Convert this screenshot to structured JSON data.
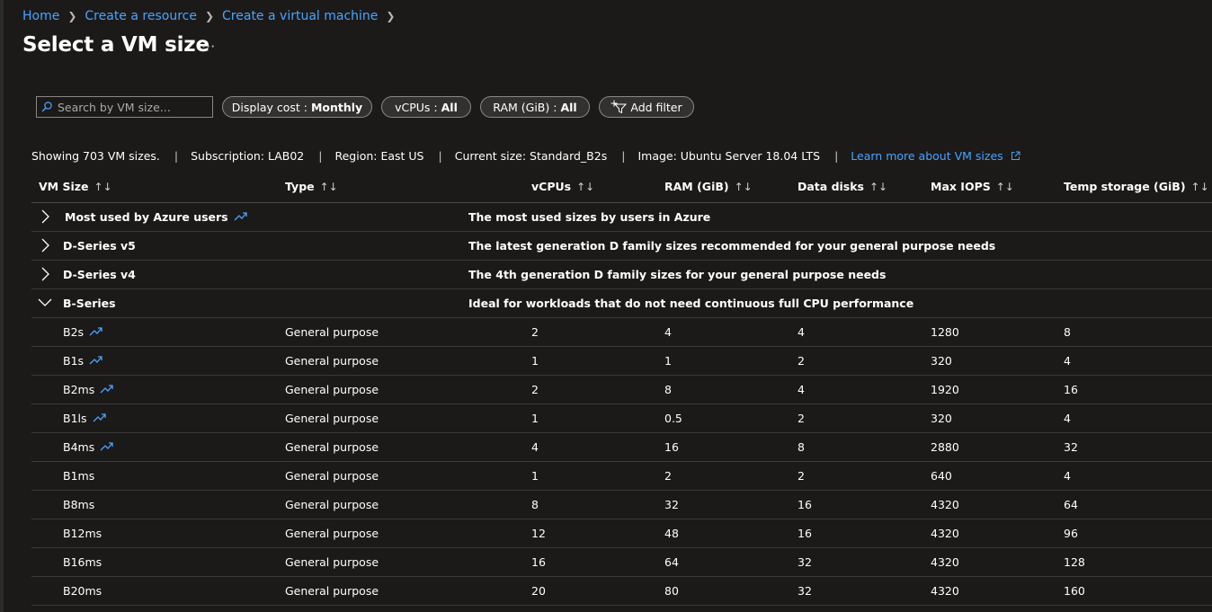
{
  "breadcrumb": {
    "home": "Home",
    "create_resource": "Create a resource",
    "create_vm": "Create a virtual machine"
  },
  "page": {
    "title": "Select a VM size",
    "more": "···"
  },
  "toolbar": {
    "search_placeholder": "Search by VM size...",
    "display_cost_label": "Display cost :",
    "display_cost_value": "Monthly",
    "vcpus_label": "vCPUs :",
    "vcpus_value": "All",
    "ram_label": "RAM (GiB) :",
    "ram_value": "All",
    "add_filter": "Add filter"
  },
  "summary": {
    "showing": "Showing 703 VM sizes.",
    "subscription": "Subscription: LAB02",
    "region": "Region: East US",
    "current_size": "Current size: Standard_B2s",
    "image": "Image: Ubuntu Server 18.04 LTS",
    "learn_more": "Learn more about VM sizes"
  },
  "columns": [
    "VM Size",
    "Type",
    "vCPUs",
    "RAM (GiB)",
    "Data disks",
    "Max IOPS",
    "Temp storage (GiB)"
  ],
  "groups": [
    {
      "name": "Most used by Azure users",
      "description": "The most used sizes by users in Azure",
      "expanded": false,
      "trend_icon": true
    },
    {
      "name": "D-Series v5",
      "description": "The latest generation D family sizes recommended for your general purpose needs",
      "expanded": false,
      "trend_icon": false
    },
    {
      "name": "D-Series v4",
      "description": "The 4th generation D family sizes for your general purpose needs",
      "expanded": false,
      "trend_icon": false
    },
    {
      "name": "B-Series",
      "description": "Ideal for workloads that do not need continuous full CPU performance",
      "expanded": true,
      "trend_icon": false
    }
  ],
  "rows": [
    {
      "size": "B2s",
      "trend": true,
      "type": "General purpose",
      "vcpus": "2",
      "ram": "4",
      "disks": "4",
      "iops": "1280",
      "temp": "8"
    },
    {
      "size": "B1s",
      "trend": true,
      "type": "General purpose",
      "vcpus": "1",
      "ram": "1",
      "disks": "2",
      "iops": "320",
      "temp": "4"
    },
    {
      "size": "B2ms",
      "trend": true,
      "type": "General purpose",
      "vcpus": "2",
      "ram": "8",
      "disks": "4",
      "iops": "1920",
      "temp": "16"
    },
    {
      "size": "B1ls",
      "trend": true,
      "type": "General purpose",
      "vcpus": "1",
      "ram": "0.5",
      "disks": "2",
      "iops": "320",
      "temp": "4"
    },
    {
      "size": "B4ms",
      "trend": true,
      "type": "General purpose",
      "vcpus": "4",
      "ram": "16",
      "disks": "8",
      "iops": "2880",
      "temp": "32"
    },
    {
      "size": "B1ms",
      "trend": false,
      "type": "General purpose",
      "vcpus": "1",
      "ram": "2",
      "disks": "2",
      "iops": "640",
      "temp": "4"
    },
    {
      "size": "B8ms",
      "trend": false,
      "type": "General purpose",
      "vcpus": "8",
      "ram": "32",
      "disks": "16",
      "iops": "4320",
      "temp": "64"
    },
    {
      "size": "B12ms",
      "trend": false,
      "type": "General purpose",
      "vcpus": "12",
      "ram": "48",
      "disks": "16",
      "iops": "4320",
      "temp": "96"
    },
    {
      "size": "B16ms",
      "trend": false,
      "type": "General purpose",
      "vcpus": "16",
      "ram": "64",
      "disks": "32",
      "iops": "4320",
      "temp": "128"
    },
    {
      "size": "B20ms",
      "trend": false,
      "type": "General purpose",
      "vcpus": "20",
      "ram": "80",
      "disks": "32",
      "iops": "4320",
      "temp": "160"
    }
  ],
  "colors": {
    "background": "#1b1a19",
    "link": "#4aa3ff",
    "trend_icon": "#4aa3ff",
    "border": "#3b3a39"
  }
}
